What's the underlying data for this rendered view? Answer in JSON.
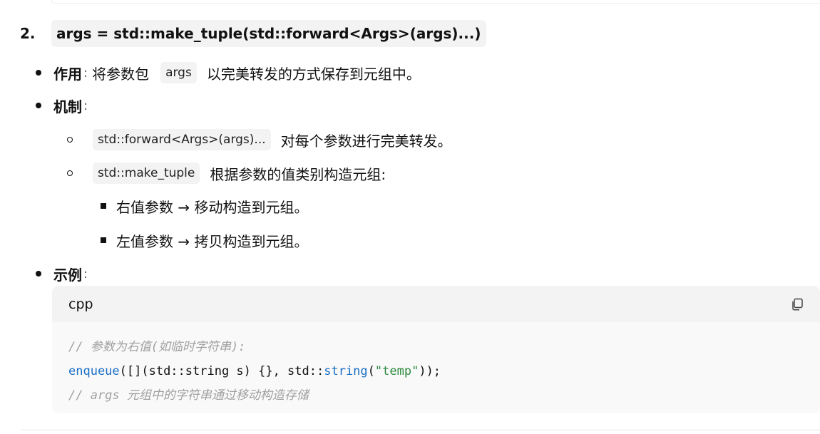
{
  "heading": {
    "number": "2.",
    "code": "args = std::make_tuple(std::forward<Args>(args)...)"
  },
  "items": {
    "purpose": {
      "label": "作用",
      "sep": ":",
      "text_before": "将参数包",
      "code": "args",
      "text_after": "以完美转发的方式保存到元组中。"
    },
    "mechanism": {
      "label": "机制",
      "sep": ":",
      "sub": [
        {
          "code": "std::forward<Args>(args)...",
          "text": "对每个参数进行完美转发。"
        },
        {
          "code": "std::make_tuple",
          "text": "根据参数的值类别构造元组:"
        }
      ],
      "subsub": [
        "右值参数 → 移动构造到元组。",
        "左值参数 → 拷贝构造到元组。"
      ]
    },
    "example": {
      "label": "示例",
      "sep": ":"
    }
  },
  "codeblock": {
    "language": "cpp",
    "copy_icon": "copy-icon",
    "line1_comment": "// 参数为右值(如临时字符串):",
    "line2": {
      "fn1": "enqueue",
      "mid": "([](std::string s) {}, std::",
      "fn2": "string",
      "open": "(",
      "str": "\"temp\"",
      "close": "));"
    },
    "line3_comment": "// args 元组中的字符串通过移动构造存储"
  }
}
